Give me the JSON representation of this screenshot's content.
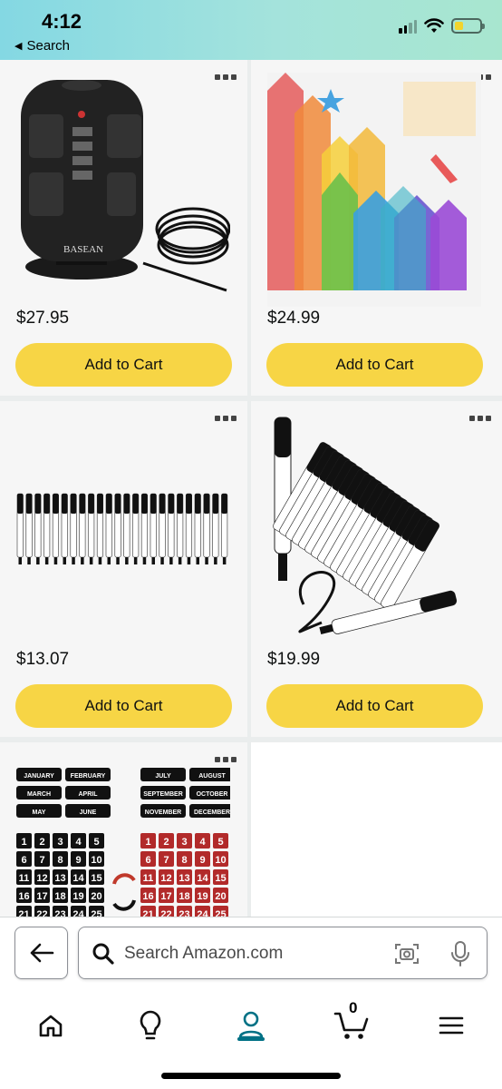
{
  "status": {
    "time": "4:12",
    "back_label": "Search"
  },
  "products": [
    {
      "price": "$27.95",
      "cta": "Add to Cart",
      "image": "power-strip-tower",
      "brand": "BASEAN"
    },
    {
      "price": "$24.99",
      "cta": "Add to Cart",
      "image": "magnetic-tiles"
    },
    {
      "price": "$13.07",
      "cta": "Add to Cart",
      "image": "marker-row"
    },
    {
      "price": "$19.99",
      "cta": "Add to Cart",
      "image": "marker-pack"
    },
    {
      "image": "calendar-magnets",
      "months": [
        "JANUARY",
        "FEBRUARY",
        "MARCH",
        "APRIL",
        "MAY",
        "JUNE",
        "JULY",
        "AUGUST",
        "SEPTEMBER",
        "OCTOBER",
        "NOVEMBER",
        "DECEMBER"
      ]
    }
  ],
  "search": {
    "placeholder": "Search Amazon.com"
  },
  "tabs": [
    "home",
    "inspire",
    "account",
    "cart",
    "menu"
  ],
  "cart_count": "0",
  "colors": {
    "accent": "#007185",
    "button": "#f7d545",
    "status_gradient": "#84d8e3"
  }
}
